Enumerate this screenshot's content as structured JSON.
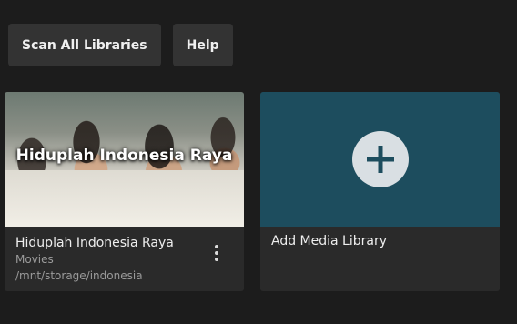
{
  "toolbar": {
    "scan_label": "Scan All Libraries",
    "help_label": "Help"
  },
  "libraries": [
    {
      "thumbnail_title": "Hiduplah Indonesia Raya",
      "title": "Hiduplah Indonesia Raya",
      "type": "Movies",
      "path": "/mnt/storage/indonesia"
    }
  ],
  "add_library": {
    "label": "Add Media Library",
    "icon": "plus-icon"
  },
  "icons": {
    "more": "more-vertical-icon"
  },
  "colors": {
    "background": "#1c1c1c",
    "card": "#2a2a2a",
    "button": "#333333",
    "add_accent": "#1d4d5e"
  }
}
